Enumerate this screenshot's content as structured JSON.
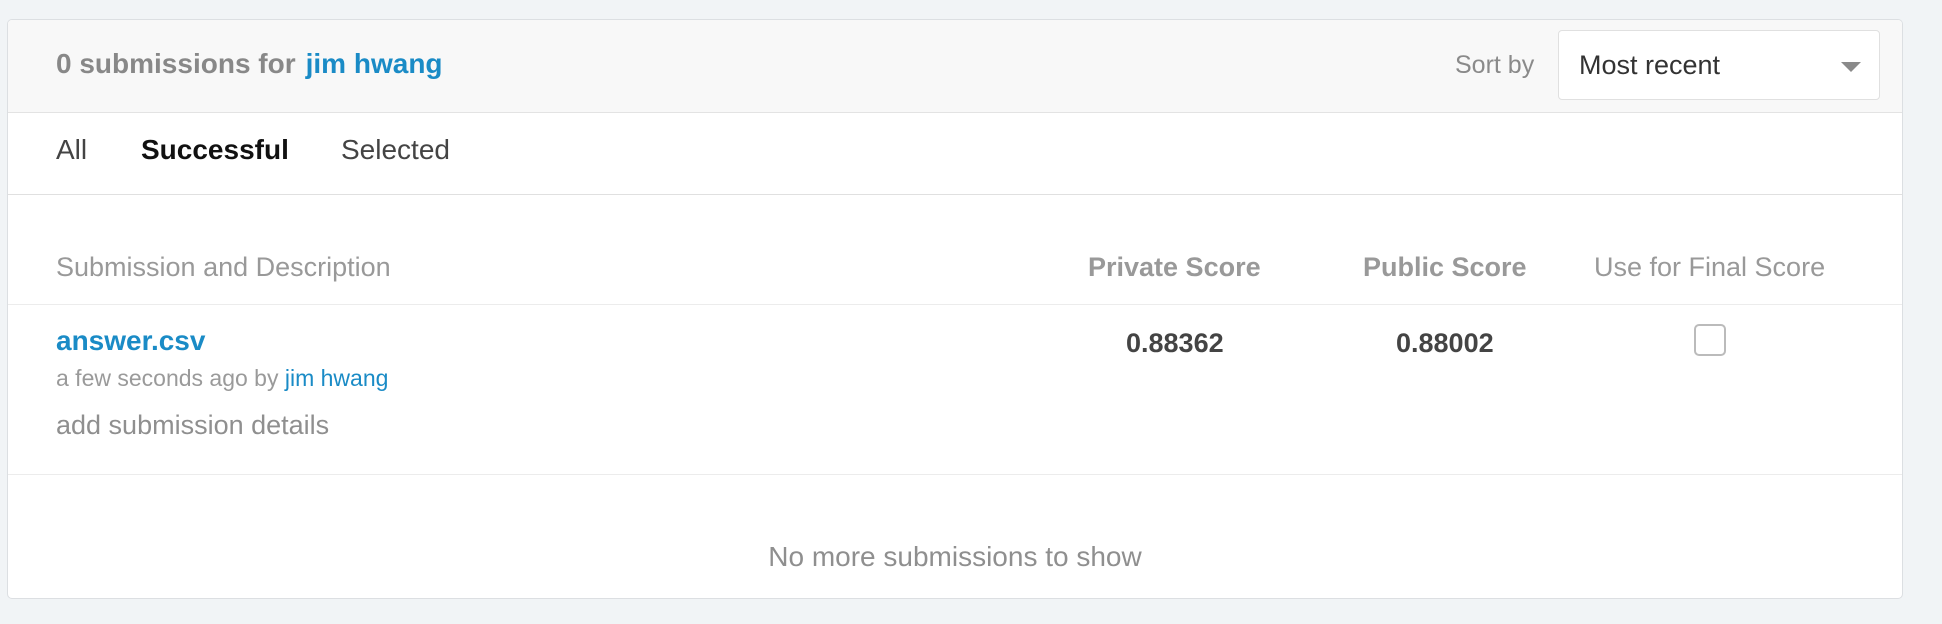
{
  "header": {
    "count_text": "0 submissions for",
    "user_name": "jim hwang",
    "sort_label": "Sort by",
    "sort_value": "Most recent"
  },
  "tabs": [
    {
      "label": "All",
      "active": false
    },
    {
      "label": "Successful",
      "active": true
    },
    {
      "label": "Selected",
      "active": false
    }
  ],
  "table": {
    "columns": {
      "submission": "Submission and Description",
      "private": "Private Score",
      "public": "Public Score",
      "final": "Use for Final Score"
    },
    "rows": [
      {
        "file": "answer.csv",
        "time_prefix": "a few seconds ago by",
        "user": "jim hwang",
        "details": "add submission details",
        "private_score": "0.88362",
        "public_score": "0.88002",
        "use_for_final": false
      }
    ]
  },
  "footer": {
    "message": "No more submissions to show"
  },
  "colors": {
    "link": "#1a8bc6",
    "background": "#f1f4f6"
  }
}
